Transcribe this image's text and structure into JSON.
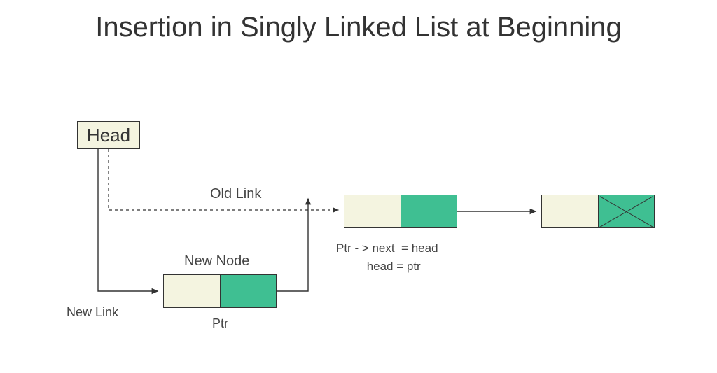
{
  "title": "Insertion in Singly Linked List at Beginning",
  "head_box_label": "Head",
  "labels": {
    "old_link": "Old Link",
    "new_node": "New Node",
    "new_link": "New Link",
    "ptr": "Ptr"
  },
  "code": "Ptr - > next  = head\n    head = ptr",
  "colors": {
    "cell_fill": "#f4f4e0",
    "ptr_fill": "#3fbf92",
    "stroke": "#333333"
  }
}
